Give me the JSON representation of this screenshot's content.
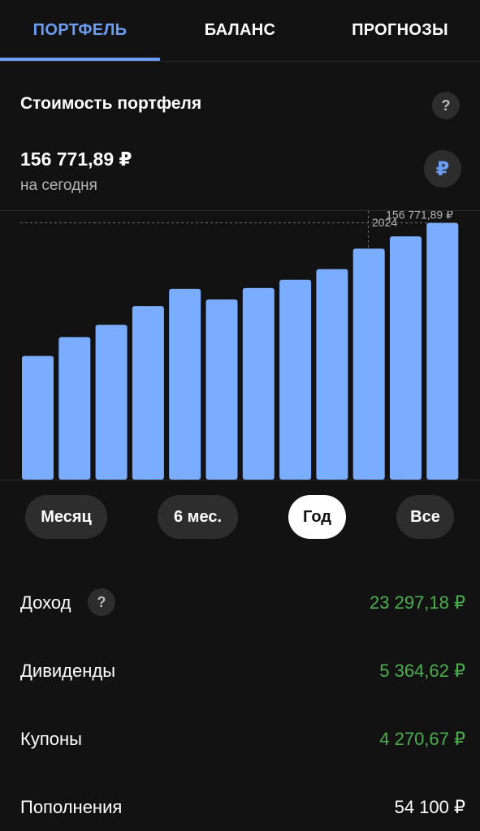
{
  "tabs": [
    {
      "label": "ПОРТФЕЛЬ",
      "active": true
    },
    {
      "label": "БАЛАНС",
      "active": false
    },
    {
      "label": "ПРОГНОЗЫ",
      "active": false
    }
  ],
  "portfolio": {
    "title": "Стоимость портфеля",
    "help": "?",
    "value": "156 771,89 ₽",
    "subtitle": "на сегодня",
    "currency_symbol": "₽"
  },
  "chart_data": {
    "type": "bar",
    "marker_label": "2024",
    "max_label": "156 771,89 ₽",
    "values": [
      75500,
      87000,
      94500,
      106000,
      116500,
      110000,
      117000,
      122000,
      128500,
      141000,
      148500,
      156771.89
    ],
    "ylim": [
      0,
      164000
    ],
    "bar_color": "#7aacff",
    "grid": false
  },
  "periods": [
    {
      "label": "Месяц",
      "active": false
    },
    {
      "label": "6 мес.",
      "active": false
    },
    {
      "label": "Год",
      "active": true
    },
    {
      "label": "Все",
      "active": false
    }
  ],
  "stats": {
    "income": {
      "label": "Доход",
      "value": "23 297,18 ₽",
      "help": "?"
    },
    "dividends": {
      "label": "Дивиденды",
      "value": "5 364,62 ₽"
    },
    "coupons": {
      "label": "Купоны",
      "value": "4 270,67 ₽"
    },
    "deposits": {
      "label": "Пополнения",
      "value": "54 100 ₽"
    }
  },
  "colors": {
    "accent": "#6b9cf2",
    "positive": "#4caf50",
    "background": "#121212"
  }
}
